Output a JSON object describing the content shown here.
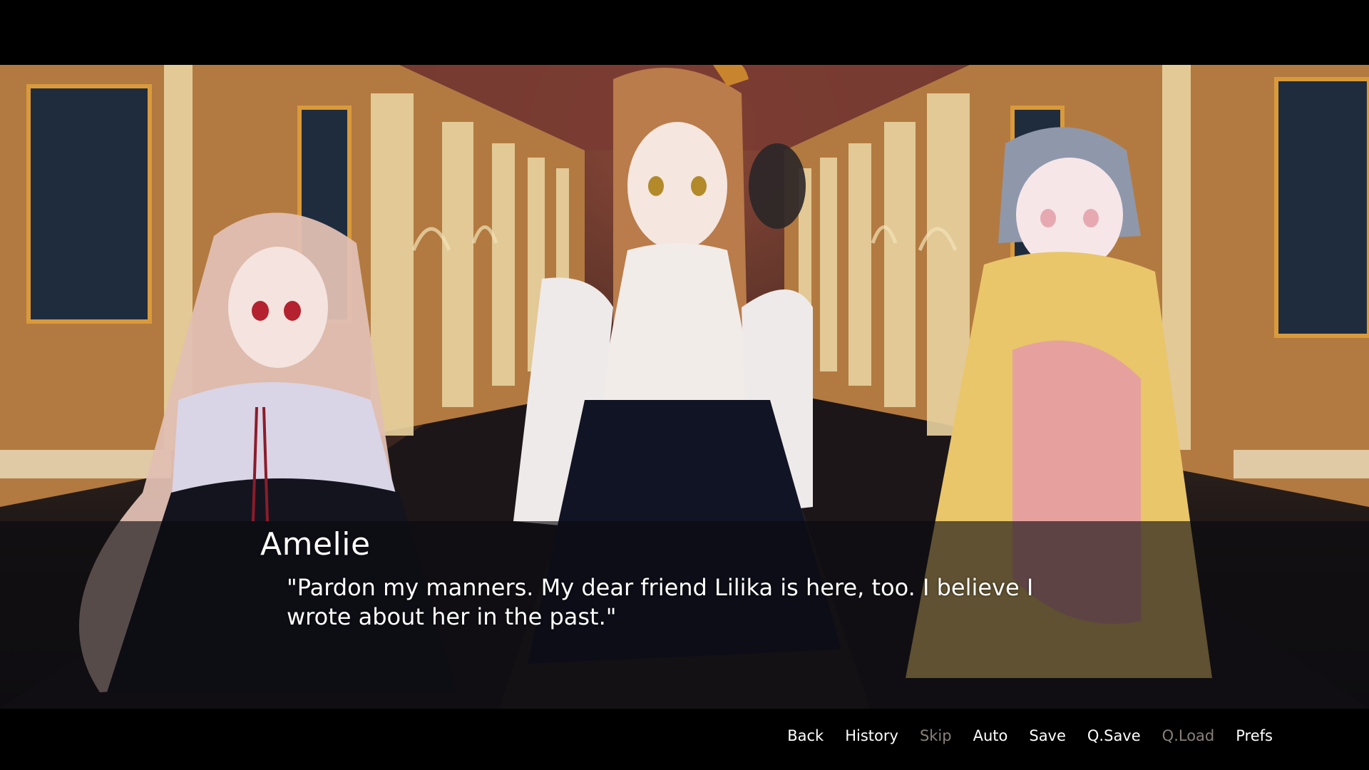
{
  "dialogue": {
    "speaker": "Amelie",
    "text": "\"Pardon my manners. My dear friend Lilika is here, too. I believe I wrote about her in the past.\""
  },
  "quick_menu": [
    {
      "label": "Back",
      "enabled": true
    },
    {
      "label": "History",
      "enabled": true
    },
    {
      "label": "Skip",
      "enabled": false
    },
    {
      "label": "Auto",
      "enabled": true
    },
    {
      "label": "Save",
      "enabled": true
    },
    {
      "label": "Q.Save",
      "enabled": true
    },
    {
      "label": "Q.Load",
      "enabled": false
    },
    {
      "label": "Prefs",
      "enabled": true
    }
  ],
  "colors": {
    "text": "#ffffff",
    "disabled_text": "#8a8078",
    "dialogue_box": "rgba(10,10,14,0.62)"
  }
}
